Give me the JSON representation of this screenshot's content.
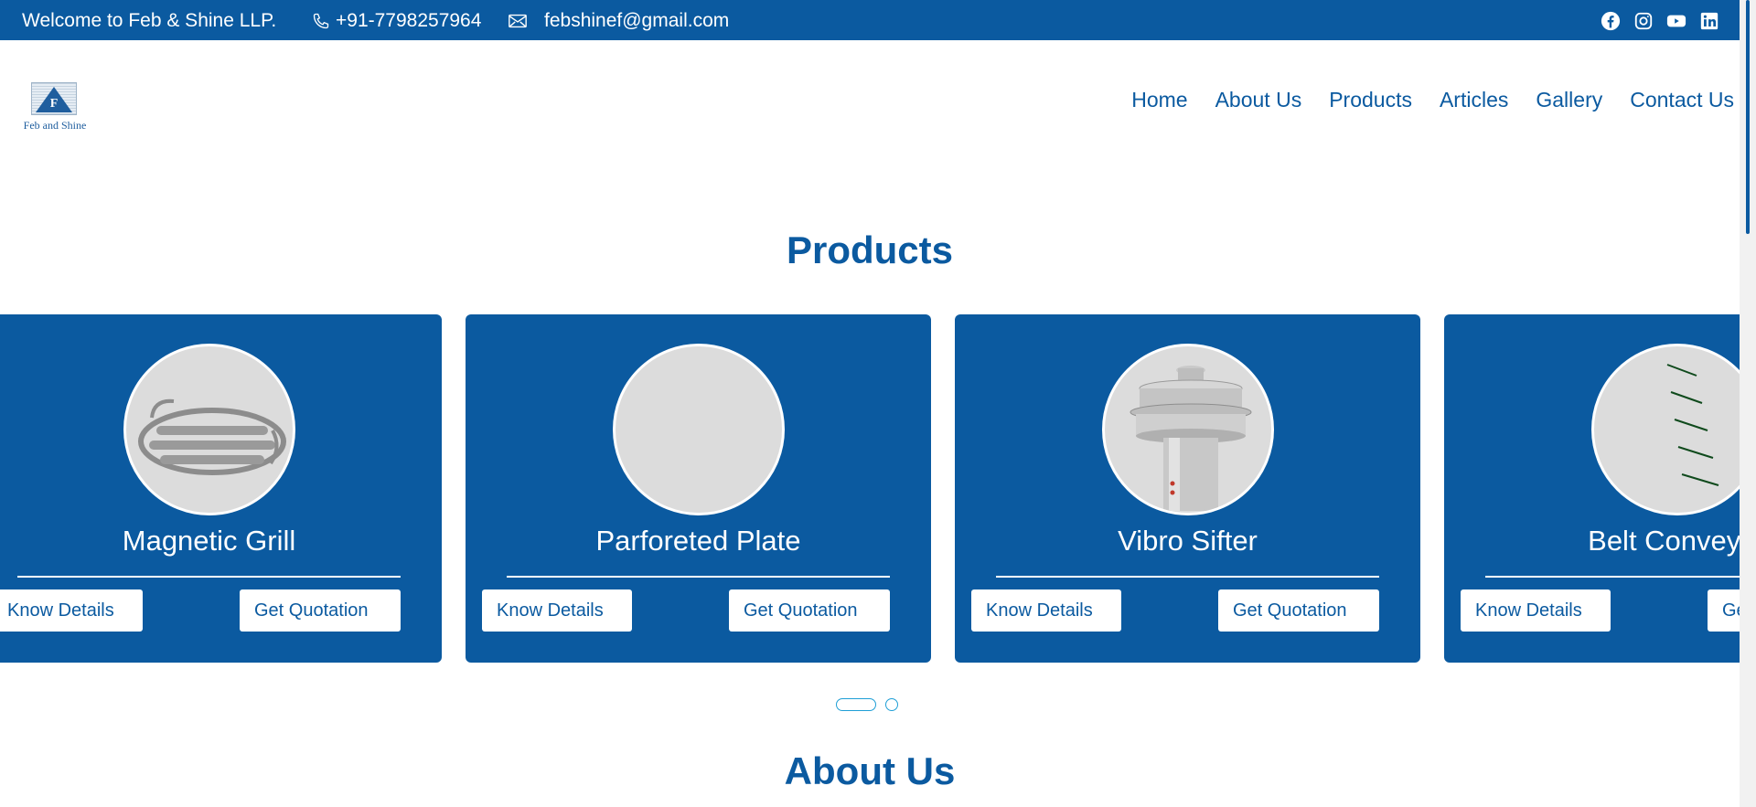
{
  "topbar": {
    "welcome": "Welcome to Feb & Shine LLP.",
    "phone": "+91-7798257964",
    "email": "febshinef@gmail.com",
    "social_icons": [
      "facebook-icon",
      "instagram-icon",
      "youtube-icon",
      "linkedin-icon"
    ]
  },
  "logo": {
    "letter": "F",
    "text": "Feb and Shine"
  },
  "nav": {
    "items": [
      {
        "label": "Home"
      },
      {
        "label": "About Us"
      },
      {
        "label": "Products"
      },
      {
        "label": "Articles"
      },
      {
        "label": "Gallery"
      },
      {
        "label": "Contact Us"
      }
    ]
  },
  "products": {
    "title": "Products",
    "items": [
      {
        "name": "Magnetic Grill",
        "details_label": "Know Details",
        "quote_label": "Get Quotation"
      },
      {
        "name": "Parforeted Plate",
        "details_label": "Know Details",
        "quote_label": "Get Quotation"
      },
      {
        "name": "Vibro Sifter",
        "details_label": "Know Details",
        "quote_label": "Get Quotation"
      },
      {
        "name": "Belt Conveyor",
        "details_label": "Know Details",
        "quote_label": "Get Quotation"
      }
    ],
    "pagination": {
      "pages": 2,
      "active": 1
    }
  },
  "about": {
    "title": "About Us"
  },
  "colors": {
    "primary": "#0b5aa0",
    "background": "#ffffff"
  }
}
